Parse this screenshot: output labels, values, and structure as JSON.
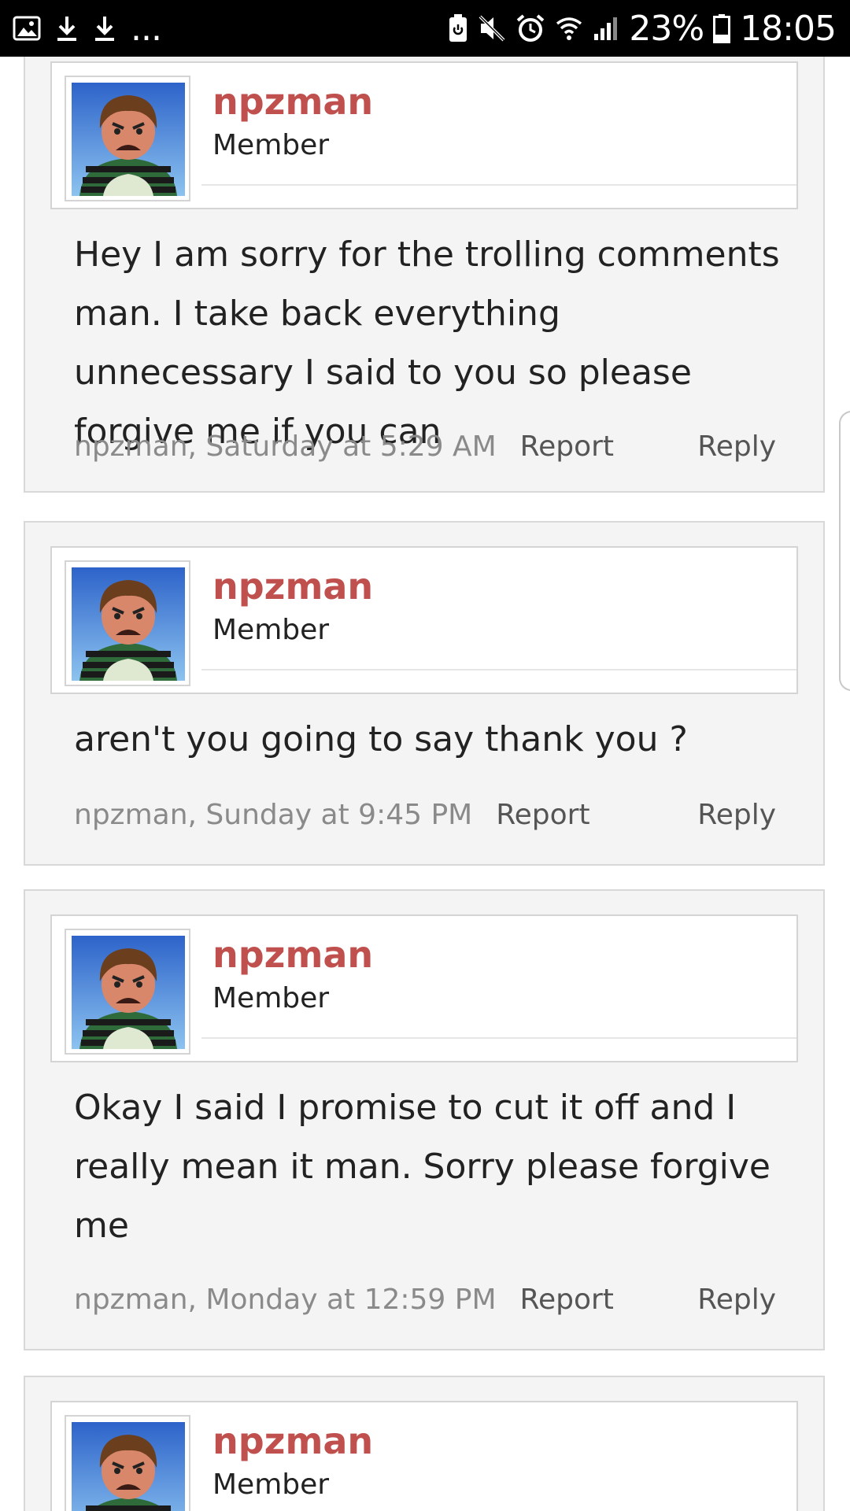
{
  "status_bar": {
    "battery_percent": "23%",
    "time": "18:05",
    "left_icons": [
      "gallery-icon",
      "download-icon",
      "download-icon",
      "more-icon"
    ],
    "right_icons": [
      "battery-saver-icon",
      "mute-icon",
      "alarm-icon",
      "wifi-icon",
      "signal-icon",
      "battery-icon"
    ],
    "more_label": "..."
  },
  "posts": [
    {
      "username": "npzman",
      "role": "Member",
      "message": "Hey I am sorry for the trolling comments man. I take back everything unnecessary I said to you so please forgive me if you can",
      "byline": "npzman, Saturday at 5:29 AM",
      "report_label": "Report",
      "reply_label": "Reply"
    },
    {
      "username": "npzman",
      "role": "Member",
      "message": "aren't you going to say thank you ?",
      "byline": "npzman, Sunday at 9:45 PM",
      "report_label": "Report",
      "reply_label": "Reply"
    },
    {
      "username": "npzman",
      "role": "Member",
      "message": "Okay I said I promise to cut it off and I really mean it man. Sorry please forgive me",
      "byline": "npzman, Monday at 12:59 PM",
      "report_label": "Report",
      "reply_label": "Reply"
    },
    {
      "username": "npzman",
      "role": "Member"
    }
  ],
  "colors": {
    "username": "#c0504d",
    "post_background": "#f4f4f4",
    "status_bar": "#000000"
  }
}
